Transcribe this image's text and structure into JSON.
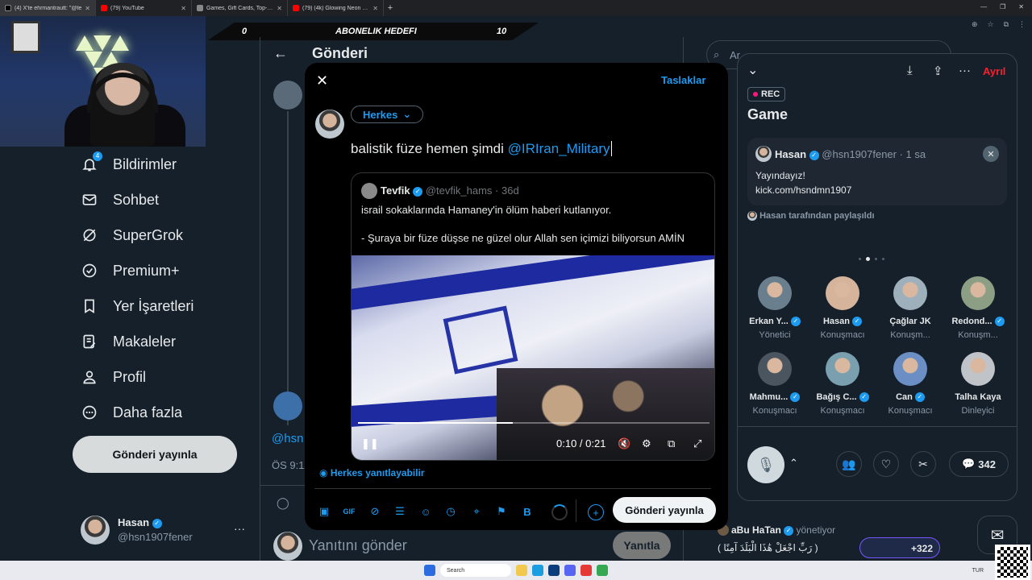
{
  "browser": {
    "tabs": [
      {
        "title": "(4) X'te ehrmantrautt: \"@te",
        "favicon": "x-icon"
      },
      {
        "title": "(79) YouTube",
        "favicon": "youtube-icon"
      },
      {
        "title": "Games, Gift Cards, Top-Ups & V",
        "favicon": "shop-icon"
      },
      {
        "title": "(79) (4k) Glowing Neon Circle",
        "favicon": "youtube-icon"
      }
    ]
  },
  "overlay": {
    "abonelik_left": "0",
    "abonelik_title": "ABONELIK HEDEFI",
    "abonelik_right": "10"
  },
  "sidebar": {
    "notif_count": "4",
    "items": [
      {
        "label": "Bildirimler",
        "icon": "bell-icon"
      },
      {
        "label": "Sohbet",
        "icon": "mail-icon"
      },
      {
        "label": "SuperGrok",
        "icon": "grok-icon"
      },
      {
        "label": "Premium+",
        "icon": "verified-icon"
      },
      {
        "label": "Yer İşaretleri",
        "icon": "bookmark-icon"
      },
      {
        "label": "Makaleler",
        "icon": "article-icon"
      },
      {
        "label": "Profil",
        "icon": "person-icon"
      },
      {
        "label": "Daha fazla",
        "icon": "more-icon"
      }
    ],
    "post_button": "Gönderi yayınla",
    "account": {
      "name": "Hasan",
      "handle": "@hsn1907fener",
      "more": "···"
    }
  },
  "main": {
    "title": "Gönderi",
    "partial_handle": "@hsn",
    "partial_time": "ÖS 9:1",
    "reply_placeholder": "Yanıtını gönder",
    "reply_button": "Yanıtla"
  },
  "modal": {
    "drafts": "Taslaklar",
    "audience": "Herkes",
    "text": "balistik füze hemen şimdi ",
    "mention": "@IRIran_Military",
    "quoted": {
      "name": "Tevfik",
      "handle": "@tevfik_hams",
      "time": "· 36d",
      "line1": "israil sokaklarında Hamaney'in ölüm haberi kutlanıyor.",
      "line2": "- Şuraya bir füze düşse ne güzel olur Allah sen içimizi biliyorsun AMİN"
    },
    "video": {
      "time": "0:10 / 0:21",
      "progress": 0.44
    },
    "reply_setting": "Herkes yanıtlayabilir",
    "send_button": "Gönderi yayınla",
    "bold": "B"
  },
  "space": {
    "leave": "Ayrıl",
    "rec": "REC",
    "title": "Game",
    "pinned": {
      "name": "Hasan",
      "handle": "@hsn1907fener · 1 sa",
      "line1": "Yayındayız!",
      "line2": "kick.com/hsndmn1907"
    },
    "shared_by": "Hasan tarafından paylaşıldı",
    "speakers": [
      {
        "name": "Erkan Y...",
        "role": "Yönetici",
        "verified": true
      },
      {
        "name": "Hasan",
        "role": "Konuşmacı",
        "verified": true
      },
      {
        "name": "Çağlar JK",
        "role": "Konuşm...",
        "verified": false
      },
      {
        "name": "Redond...",
        "role": "Konuşm...",
        "verified": true
      },
      {
        "name": "Mahmu...",
        "role": "Konuşmacı",
        "verified": true
      },
      {
        "name": "Bağış C...",
        "role": "Konuşmacı",
        "verified": true
      },
      {
        "name": "Can",
        "role": "Konuşmacı",
        "verified": true
      },
      {
        "name": "Talha Kaya",
        "role": "Dinleyici",
        "verified": false
      }
    ],
    "comment_count": "342"
  },
  "behind": {
    "search_partial": "Ar",
    "listener_name": "aBu HaTan",
    "listener_status": "yönetiyor",
    "listener_text": "( رَبِّ اجْعَلْ هَٰذَا الْبَلَدَ آمِنًا )",
    "listener_count": "+322"
  },
  "taskbar": {
    "search": "Search",
    "lang": "TUR"
  }
}
